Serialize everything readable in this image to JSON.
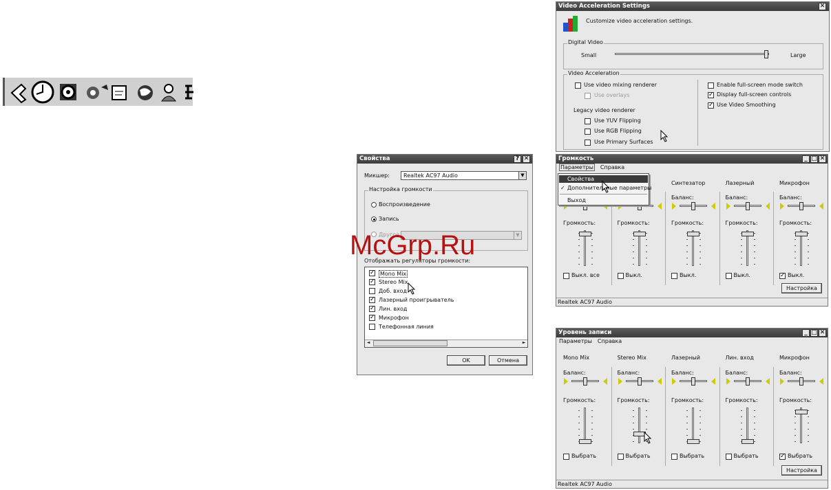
{
  "watermark": "McGrp.Ru",
  "video": {
    "title": "Video Acceleration Settings",
    "close": "✕",
    "subtitle": "Customize video acceleration settings.",
    "digital_group": "Digital Video",
    "small": "Small",
    "large": "Large",
    "slider_level": 0.98,
    "accel_group": "Video Acceleration",
    "mixing": "Use video mixing renderer",
    "overlays": "Use overlays",
    "legacy": "Legacy video renderer",
    "yuv": "Use YUV Flipping",
    "rgb": "Use RGB Flipping",
    "primary": "Use Primary Surfaces",
    "fullscreen_switch": "Enable full-screen mode switch",
    "fullscreen_controls": "Display full-screen controls",
    "smoothing": "Use Video Smoothing"
  },
  "props": {
    "title": "Свойства",
    "help": "?",
    "close": "✕",
    "mixer_label": "Микшер:",
    "mixer_value": "Realtek AC97 Audio",
    "group": "Настройка громкости",
    "playback": "Воспроизведение",
    "record": "Запись",
    "other": "Другое",
    "list_label": "Отображать регуляторы громкости:",
    "items": [
      {
        "label": "Mono Mix",
        "checked": "✓"
      },
      {
        "label": "Stereo Mix",
        "checked": "✓"
      },
      {
        "label": "Доб. вход",
        "checked": ""
      },
      {
        "label": "Лазерный проигрыватель",
        "checked": "✓"
      },
      {
        "label": "Лин. вход",
        "checked": "✓"
      },
      {
        "label": "Микрофон",
        "checked": "✓"
      },
      {
        "label": "Телефонная линия",
        "checked": ""
      }
    ],
    "ok": "OK",
    "cancel": "Отмена"
  },
  "volume": {
    "title": "Громкость",
    "menu_params": "Параметры",
    "menu_help": "Справка",
    "dropdown": [
      "Свойства",
      "Дополнительные параметры",
      "Выход"
    ],
    "dropdown_check": "✓",
    "columns": [
      "",
      "",
      "Синтезатор",
      "Лазерный",
      "Микрофон"
    ],
    "balance": "Баланс:",
    "volume": "Громкость:",
    "mute_all": "Выкл. все",
    "mute": "Выкл.",
    "advanced": "Настройка",
    "status": "Realtek AC97 Audio"
  },
  "record": {
    "title": "Уровень записи",
    "menu_params": "Параметры",
    "menu_help": "Справка",
    "columns": [
      "Mono Mix",
      "Stereo Mix",
      "Лазерный",
      "Лин. вход",
      "Микрофон"
    ],
    "balance": "Баланс:",
    "volume": "Громкость:",
    "select": "Выбрать",
    "advanced": "Настройка",
    "status": "Realtek AC97 Audio"
  },
  "colors": {
    "titlebar": "#444444",
    "watermark": "#b30000"
  },
  "toolbar_icons": [
    "back-arrow-icon",
    "clock-icon",
    "disc-icon",
    "gear-icon",
    "document-icon",
    "globe-icon",
    "user-icon",
    "network-icon"
  ]
}
